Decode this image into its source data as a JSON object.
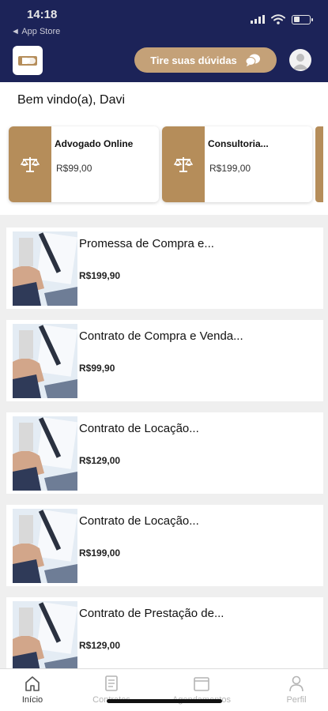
{
  "status_bar": {
    "time": "14:18",
    "back_label": "◄ App Store"
  },
  "header": {
    "help_button_label": "Tire suas dúvidas"
  },
  "welcome": {
    "text": "Bem vindo(a), Davi"
  },
  "services": [
    {
      "title": "Advogado Online",
      "price": "R$99,00"
    },
    {
      "title": "Consultoria...",
      "price": "R$199,00"
    }
  ],
  "products": [
    {
      "title": "Promessa de Compra e...",
      "price": "R$199,90"
    },
    {
      "title": "Contrato de Compra e Venda...",
      "price": "R$99,90"
    },
    {
      "title": "Contrato de Locação...",
      "price": "R$129,00"
    },
    {
      "title": "Contrato de Locação...",
      "price": "R$199,00"
    },
    {
      "title": "Contrato de Prestação de...",
      "price": "R$129,00"
    }
  ],
  "tabbar": {
    "items": [
      {
        "label": "Início",
        "icon": "home-icon",
        "active": true
      },
      {
        "label": "Contratos",
        "icon": "document-icon",
        "active": false
      },
      {
        "label": "Agendamentos",
        "icon": "calendar-icon",
        "active": false
      },
      {
        "label": "Perfil",
        "icon": "user-icon",
        "active": false
      }
    ]
  },
  "colors": {
    "header": "#1c2358",
    "accent": "#c4a178",
    "gold": "#b58d5a"
  }
}
